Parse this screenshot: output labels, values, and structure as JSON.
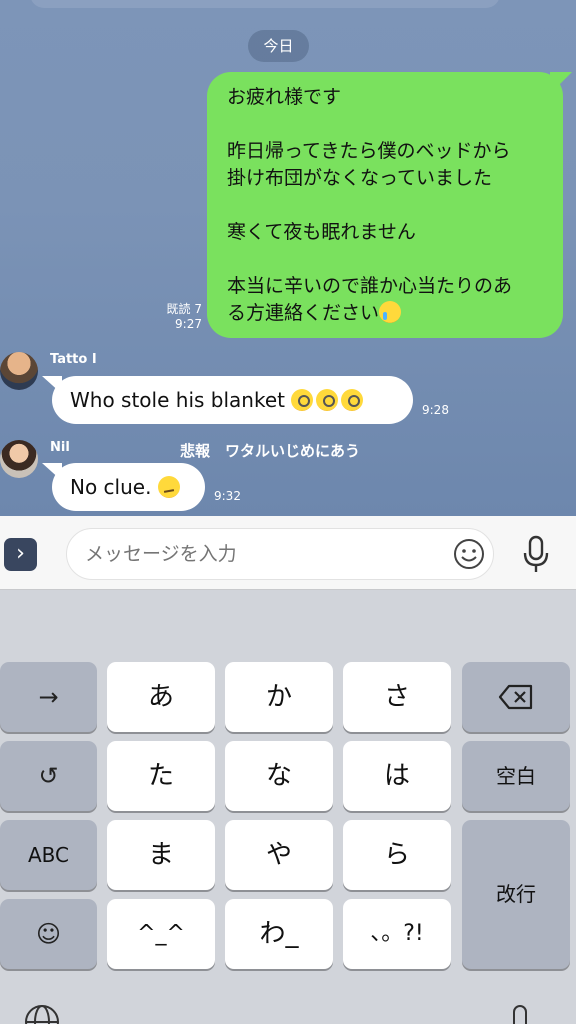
{
  "chat": {
    "date_label": "今日",
    "outgoing": {
      "lines": [
        "お疲れ様です",
        "",
        "昨日帰ってきたら僕のベッドから",
        "掛け布団がなくなっていました",
        "",
        "寒くて夜も眠れません",
        "",
        "本当に辛いので誰か心当たりのあ",
        "る方連絡ください"
      ],
      "read_label": "既読 7",
      "time": "9:27"
    },
    "messages": [
      {
        "sender": "Tatto I",
        "text": "Who stole his blanket",
        "time": "9:28",
        "emoji": [
          "monocle-face-emoji",
          "monocle-face-emoji",
          "monocle-face-emoji"
        ]
      },
      {
        "sender": "Nil",
        "text": "No clue.",
        "time": "9:32",
        "emoji": [
          "confused-face-emoji"
        ]
      }
    ],
    "banner": "悲報　ワタルいじめにあう"
  },
  "input": {
    "placeholder": "メッセージを入力"
  },
  "keyboard": {
    "left_col": [
      "→",
      "↺",
      "ABC",
      "☺"
    ],
    "rows": [
      [
        "あ",
        "か",
        "さ"
      ],
      [
        "た",
        "な",
        "は"
      ],
      [
        "ま",
        "や",
        "ら"
      ],
      [
        "^_^",
        "わ_",
        "、。?!"
      ]
    ],
    "space_label": "空白",
    "enter_label": "改行"
  }
}
